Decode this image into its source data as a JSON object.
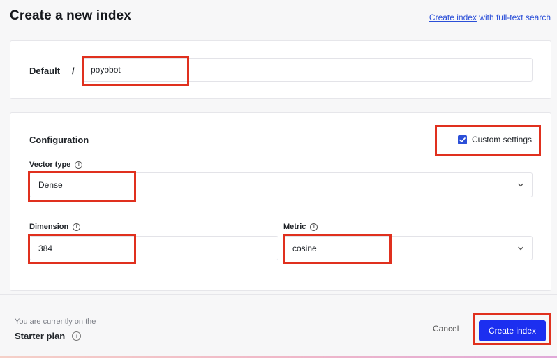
{
  "header": {
    "title": "Create a new index",
    "alt_link": "Create index",
    "alt_link_suffix": " with full-text search"
  },
  "name_section": {
    "project_label": "Default",
    "separator": "/",
    "index_name": "poyobot"
  },
  "config": {
    "title": "Configuration",
    "custom_settings_label": "Custom settings",
    "custom_settings_checked": true,
    "vector_type": {
      "label": "Vector type",
      "value": "Dense"
    },
    "dimension": {
      "label": "Dimension",
      "value": "384"
    },
    "metric": {
      "label": "Metric",
      "value": "cosine"
    }
  },
  "footer": {
    "plan_note": "You are currently on the",
    "plan_name": "Starter plan",
    "cancel_label": "Cancel",
    "create_label": "Create index"
  },
  "colors": {
    "accent": "#1c2ff0",
    "highlight": "#e0301e",
    "link": "#2b4fd8"
  },
  "icons": {
    "info": "info-circle-icon",
    "chevron": "chevron-down-icon",
    "check": "check-icon"
  }
}
